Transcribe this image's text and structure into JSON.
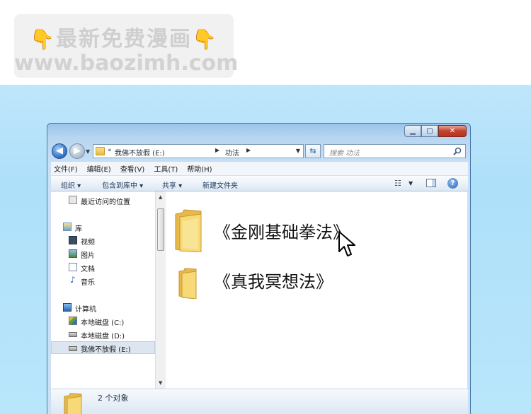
{
  "watermark": {
    "line1": "最新免费漫画",
    "line2": "www.baozimh.com",
    "hand_icon": "👇"
  },
  "window": {
    "caption_buttons": {
      "minimize": "▁",
      "maximize": "▢",
      "close": "✕"
    },
    "address": {
      "history_chevron": "«",
      "drive": "我佛不放假 (E:)",
      "folder": "功法"
    },
    "search": {
      "placeholder": "搜索 功法"
    },
    "menubar": [
      "文件(F)",
      "编辑(E)",
      "查看(V)",
      "工具(T)",
      "帮助(H)"
    ],
    "toolbar": {
      "organize": "组织 ▾",
      "include_library": "包含到库中 ▾",
      "share": "共享 ▾",
      "new_folder": "新建文件夹",
      "help": "?"
    },
    "navpane": {
      "recent": "最近访问的位置",
      "libraries": "库",
      "video": "视频",
      "pictures": "图片",
      "documents": "文档",
      "music": "音乐",
      "computer": "计算机",
      "drive_c": "本地磁盘 (C:)",
      "drive_d": "本地磁盘 (D:)",
      "drive_e": "我佛不放假 (E:)"
    },
    "files": [
      {
        "name": "《金刚基础拳法》",
        "icon": "folder-icon"
      },
      {
        "name": "《真我冥想法》",
        "icon": "folder-icon"
      }
    ],
    "status": {
      "count_text": "2 个对象"
    }
  },
  "colors": {
    "backdrop": "#aee0fa",
    "window_frame": "#9bc4e8",
    "close_button": "#c4432d",
    "folder_yellow": "#f2cf62"
  }
}
